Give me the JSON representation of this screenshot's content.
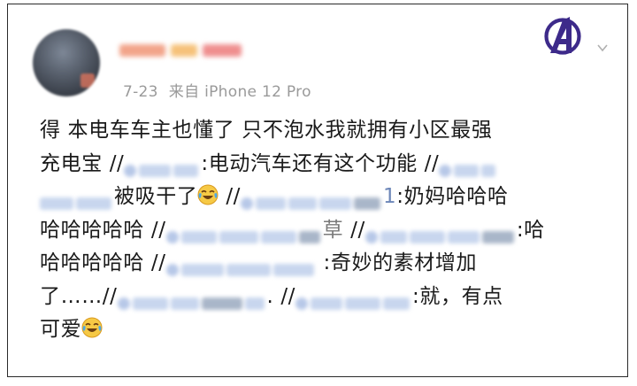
{
  "post": {
    "date": "7-23",
    "source": "来自 iPhone 12 Pro",
    "seg1": "得 本电车车主也懂了 只不泡水我就拥有小区最强",
    "seg2": "充电宝 //",
    "seg3": ":电动汽车还有这个功能 //",
    "seg4": "被吸干了",
    "seg5": " //",
    "seg6": ":奶妈哈哈哈",
    "seg7": "哈哈哈哈哈 //",
    "seg8": " //",
    "seg9": ":哈",
    "seg10": "哈哈哈哈哈 //",
    "seg11": " :奇妙的素材增加",
    "seg12": "了……//",
    "seg13": ". //",
    "seg14": ":就，有点",
    "seg15": "可爱",
    "mention_partial_1": "1",
    "mention_partial_2": "草"
  },
  "icons": {
    "logo": "avengers-logo-icon",
    "menu": "chevron-down-icon",
    "emoji": "laughing-crying-emoji-icon"
  },
  "colors": {
    "text": "#1a1a1a",
    "meta": "#9a9a9a",
    "logo": "#3d2a8a"
  }
}
